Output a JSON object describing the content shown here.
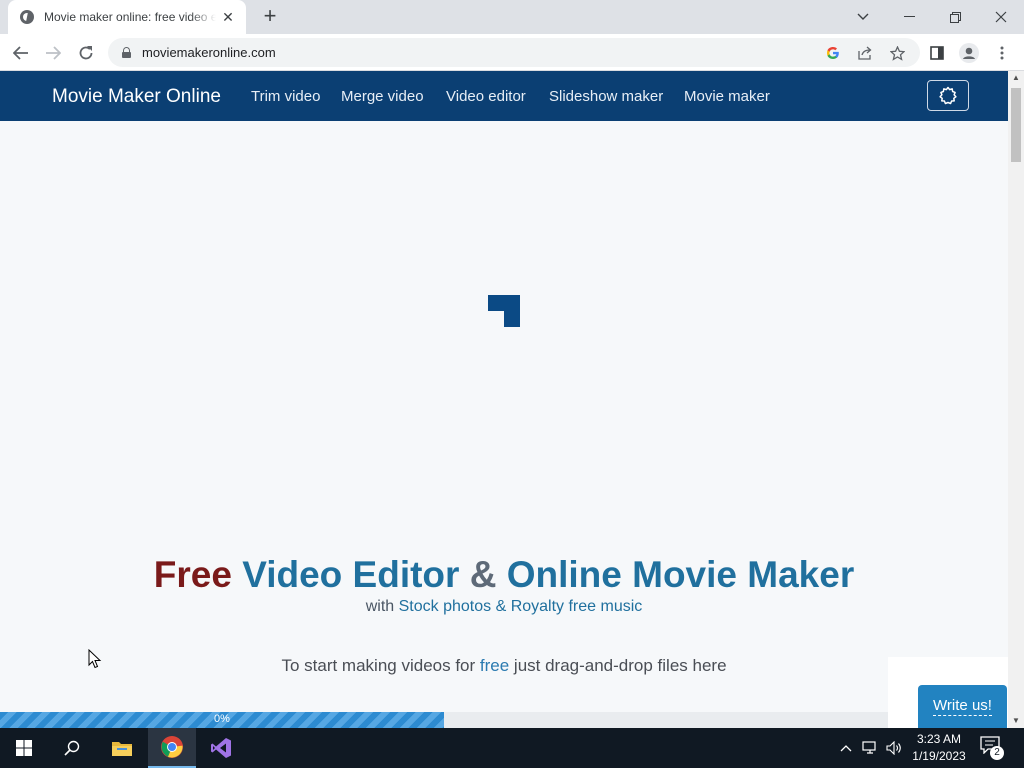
{
  "browser": {
    "tab_title": "Movie maker online: free video editor",
    "tab_close": "✕",
    "new_tab": "+",
    "url": "moviemakeronline.com",
    "window": {
      "minimize": "—",
      "restore": "❐",
      "close": "✕",
      "tab_search": "⌄"
    }
  },
  "site": {
    "brand": "Movie Maker Online",
    "nav": [
      {
        "label": "Trim video"
      },
      {
        "label": "Merge video"
      },
      {
        "label": "Video editor"
      },
      {
        "label": "Slideshow maker"
      },
      {
        "label": "Movie maker"
      }
    ],
    "headline": {
      "free": "Free",
      "video_editor": "Video Editor",
      "amp": "&",
      "movie_maker": "Online Movie Maker"
    },
    "subline": {
      "with": "with",
      "highlight": "Stock photos & Royalty free music"
    },
    "dropline": {
      "before": "To start making videos for ",
      "free": "free",
      "after": " just drag-and-drop files here"
    },
    "progress": {
      "label": "0%",
      "value": 0.5
    },
    "write_us": "Write us!"
  },
  "taskbar": {
    "time": "3:23 AM",
    "date": "1/19/2023",
    "notifications": "2"
  },
  "colors": {
    "navbar": "#0b3f73",
    "headline_free": "#7a1a1a",
    "headline_blue": "#20709e",
    "accent": "#2283c1"
  }
}
